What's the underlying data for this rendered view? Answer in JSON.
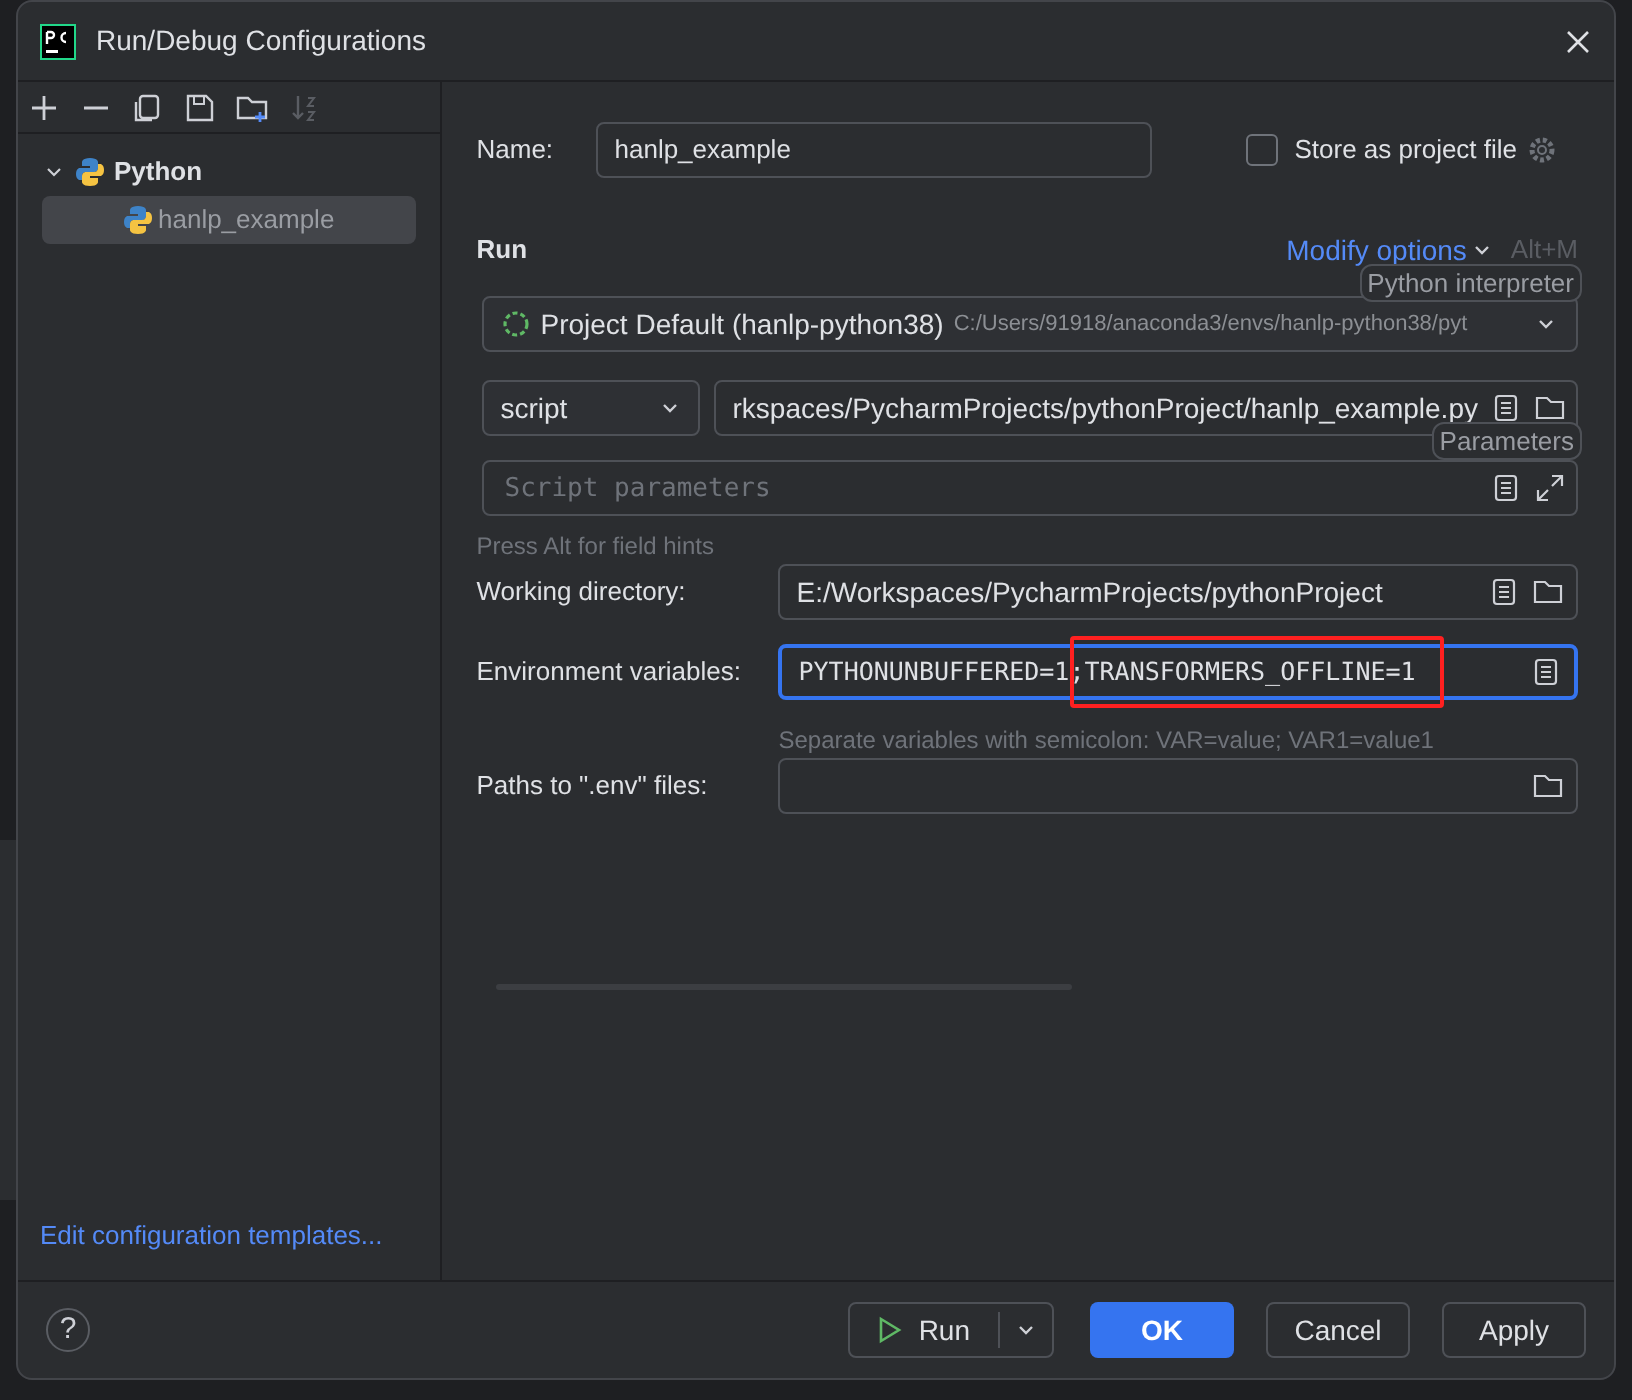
{
  "window": {
    "title": "Run/Debug Configurations"
  },
  "toolbar": {
    "tools": [
      {
        "kind": "add",
        "disabled": false
      },
      {
        "kind": "remove",
        "disabled": false
      },
      {
        "kind": "copy",
        "disabled": false
      },
      {
        "kind": "save",
        "disabled": false
      },
      {
        "kind": "folder",
        "disabled": false
      },
      {
        "kind": "sort",
        "disabled": true
      }
    ]
  },
  "tree": [
    {
      "label": "Python",
      "expanded": true,
      "selected": false,
      "children": [
        {
          "label": "hanlp_example",
          "selected": true
        }
      ]
    }
  ],
  "templates_link": "Edit configuration templates...",
  "name": {
    "label": "Name:",
    "value": "hanlp_example"
  },
  "store_as_project_file": {
    "label": "Store as project file",
    "checked": false
  },
  "run_section": {
    "title": "Run",
    "modify_options": "Modify options",
    "shortcut": "Alt+M"
  },
  "interpreter": {
    "name": "Project Default (hanlp-python38)",
    "path": "C:/Users/91918/anaconda3/envs/hanlp-python38/pyt"
  },
  "tooltips": [
    {
      "text": "Python interpreter"
    },
    {
      "text": "Parameters"
    }
  ],
  "target": {
    "type": "script",
    "value": "rkspaces/PycharmProjects/pythonProject/hanlp_example.py"
  },
  "script_parameters": {
    "placeholder": "Script parameters"
  },
  "field_hint": "Press Alt for field hints",
  "working_directory": {
    "label": "Working directory:",
    "value": "E:/Workspaces/PycharmProjects/pythonProject"
  },
  "environment_variables": {
    "label": "Environment variables:",
    "value_parts": [
      {
        "text": "PYTHONUNBUFFERED=1;",
        "highlighted": false
      },
      {
        "text": "TRANSFORMERS_OFFLINE=1",
        "highlighted": true
      }
    ],
    "focused": true,
    "hint": "Separate variables with semicolon: VAR=value; VAR1=value1"
  },
  "env_files": {
    "label": "Paths to \".env\" files:"
  },
  "help_button": "?",
  "buttons": [
    {
      "kind": "run",
      "label": "Run"
    },
    {
      "kind": "primary",
      "label": "OK"
    },
    {
      "kind": "plain",
      "label": "Cancel"
    },
    {
      "kind": "plain",
      "label": "Apply"
    }
  ]
}
